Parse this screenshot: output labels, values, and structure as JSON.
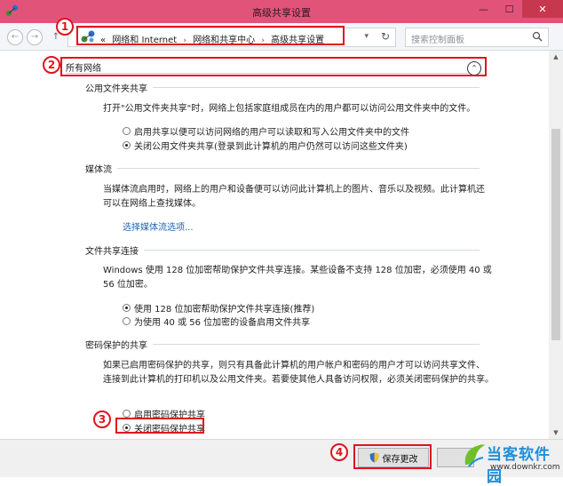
{
  "window": {
    "title": "高级共享设置",
    "buttons": {
      "minimize": "—",
      "maximize": "☐",
      "close": "✕"
    }
  },
  "navbar": {
    "back_icon": "←",
    "forward_icon": "→",
    "up_icon": "↑",
    "breadcrumb_prefix": "«",
    "breadcrumbs": [
      "网络和 Internet",
      "网络和共享中心",
      "高级共享设置"
    ],
    "breadcrumb_separator": "›",
    "dropdown_icon": "▾",
    "refresh_icon": "↻",
    "search_placeholder": "搜索控制面板"
  },
  "content": {
    "section_title": "所有网络",
    "collapse_icon": "⌃",
    "public_folder": {
      "heading": "公用文件夹共享",
      "description": "打开\"公用文件夹共享\"时，网络上包括家庭组成员在内的用户都可以访问公用文件夹中的文件。",
      "options": [
        {
          "label": "启用共享以便可以访问网络的用户可以读取和写入公用文件夹中的文件",
          "selected": false
        },
        {
          "label": "关闭公用文件夹共享(登录到此计算机的用户仍然可以访问这些文件夹)",
          "selected": true
        }
      ]
    },
    "media_stream": {
      "heading": "媒体流",
      "description_line1": "当媒体流启用时，网络上的用户和设备便可以访问此计算机上的图片、音乐以及视频。此计算机还",
      "description_line2": "可以在网络上查找媒体。",
      "link": "选择媒体流选项..."
    },
    "file_sharing": {
      "heading": "文件共享连接",
      "description_line1": "Windows 使用 128 位加密帮助保护文件共享连接。某些设备不支持 128 位加密，必须使用 40 或",
      "description_line2": "56 位加密。",
      "options": [
        {
          "label": "使用 128 位加密帮助保护文件共享连接(推荐)",
          "selected": true
        },
        {
          "label": "为使用 40 或 56 位加密的设备启用文件共享",
          "selected": false
        }
      ]
    },
    "password_sharing": {
      "heading": "密码保护的共享",
      "description_line1": "如果已启用密码保护的共享，则只有具备此计算机的用户帐户和密码的用户才可以访问共享文件、",
      "description_line2": "连接到此计算机的打印机以及公用文件夹。若要使其他人具备访问权限，必须关闭密码保护的共享。",
      "options": [
        {
          "label": "启用密码保护共享",
          "selected": false
        },
        {
          "label": "关闭密码保护共享",
          "selected": true
        }
      ]
    }
  },
  "footer": {
    "save_label": "保存更改"
  },
  "watermark": {
    "name": "当客软件园",
    "url": "www.downkr.com"
  },
  "annotations": [
    "1",
    "2",
    "3",
    "4"
  ],
  "colors": {
    "titlebar": "#e2537a",
    "close_button": "#c7384f",
    "annotation": "#e0121f",
    "link": "#1f63b8"
  }
}
